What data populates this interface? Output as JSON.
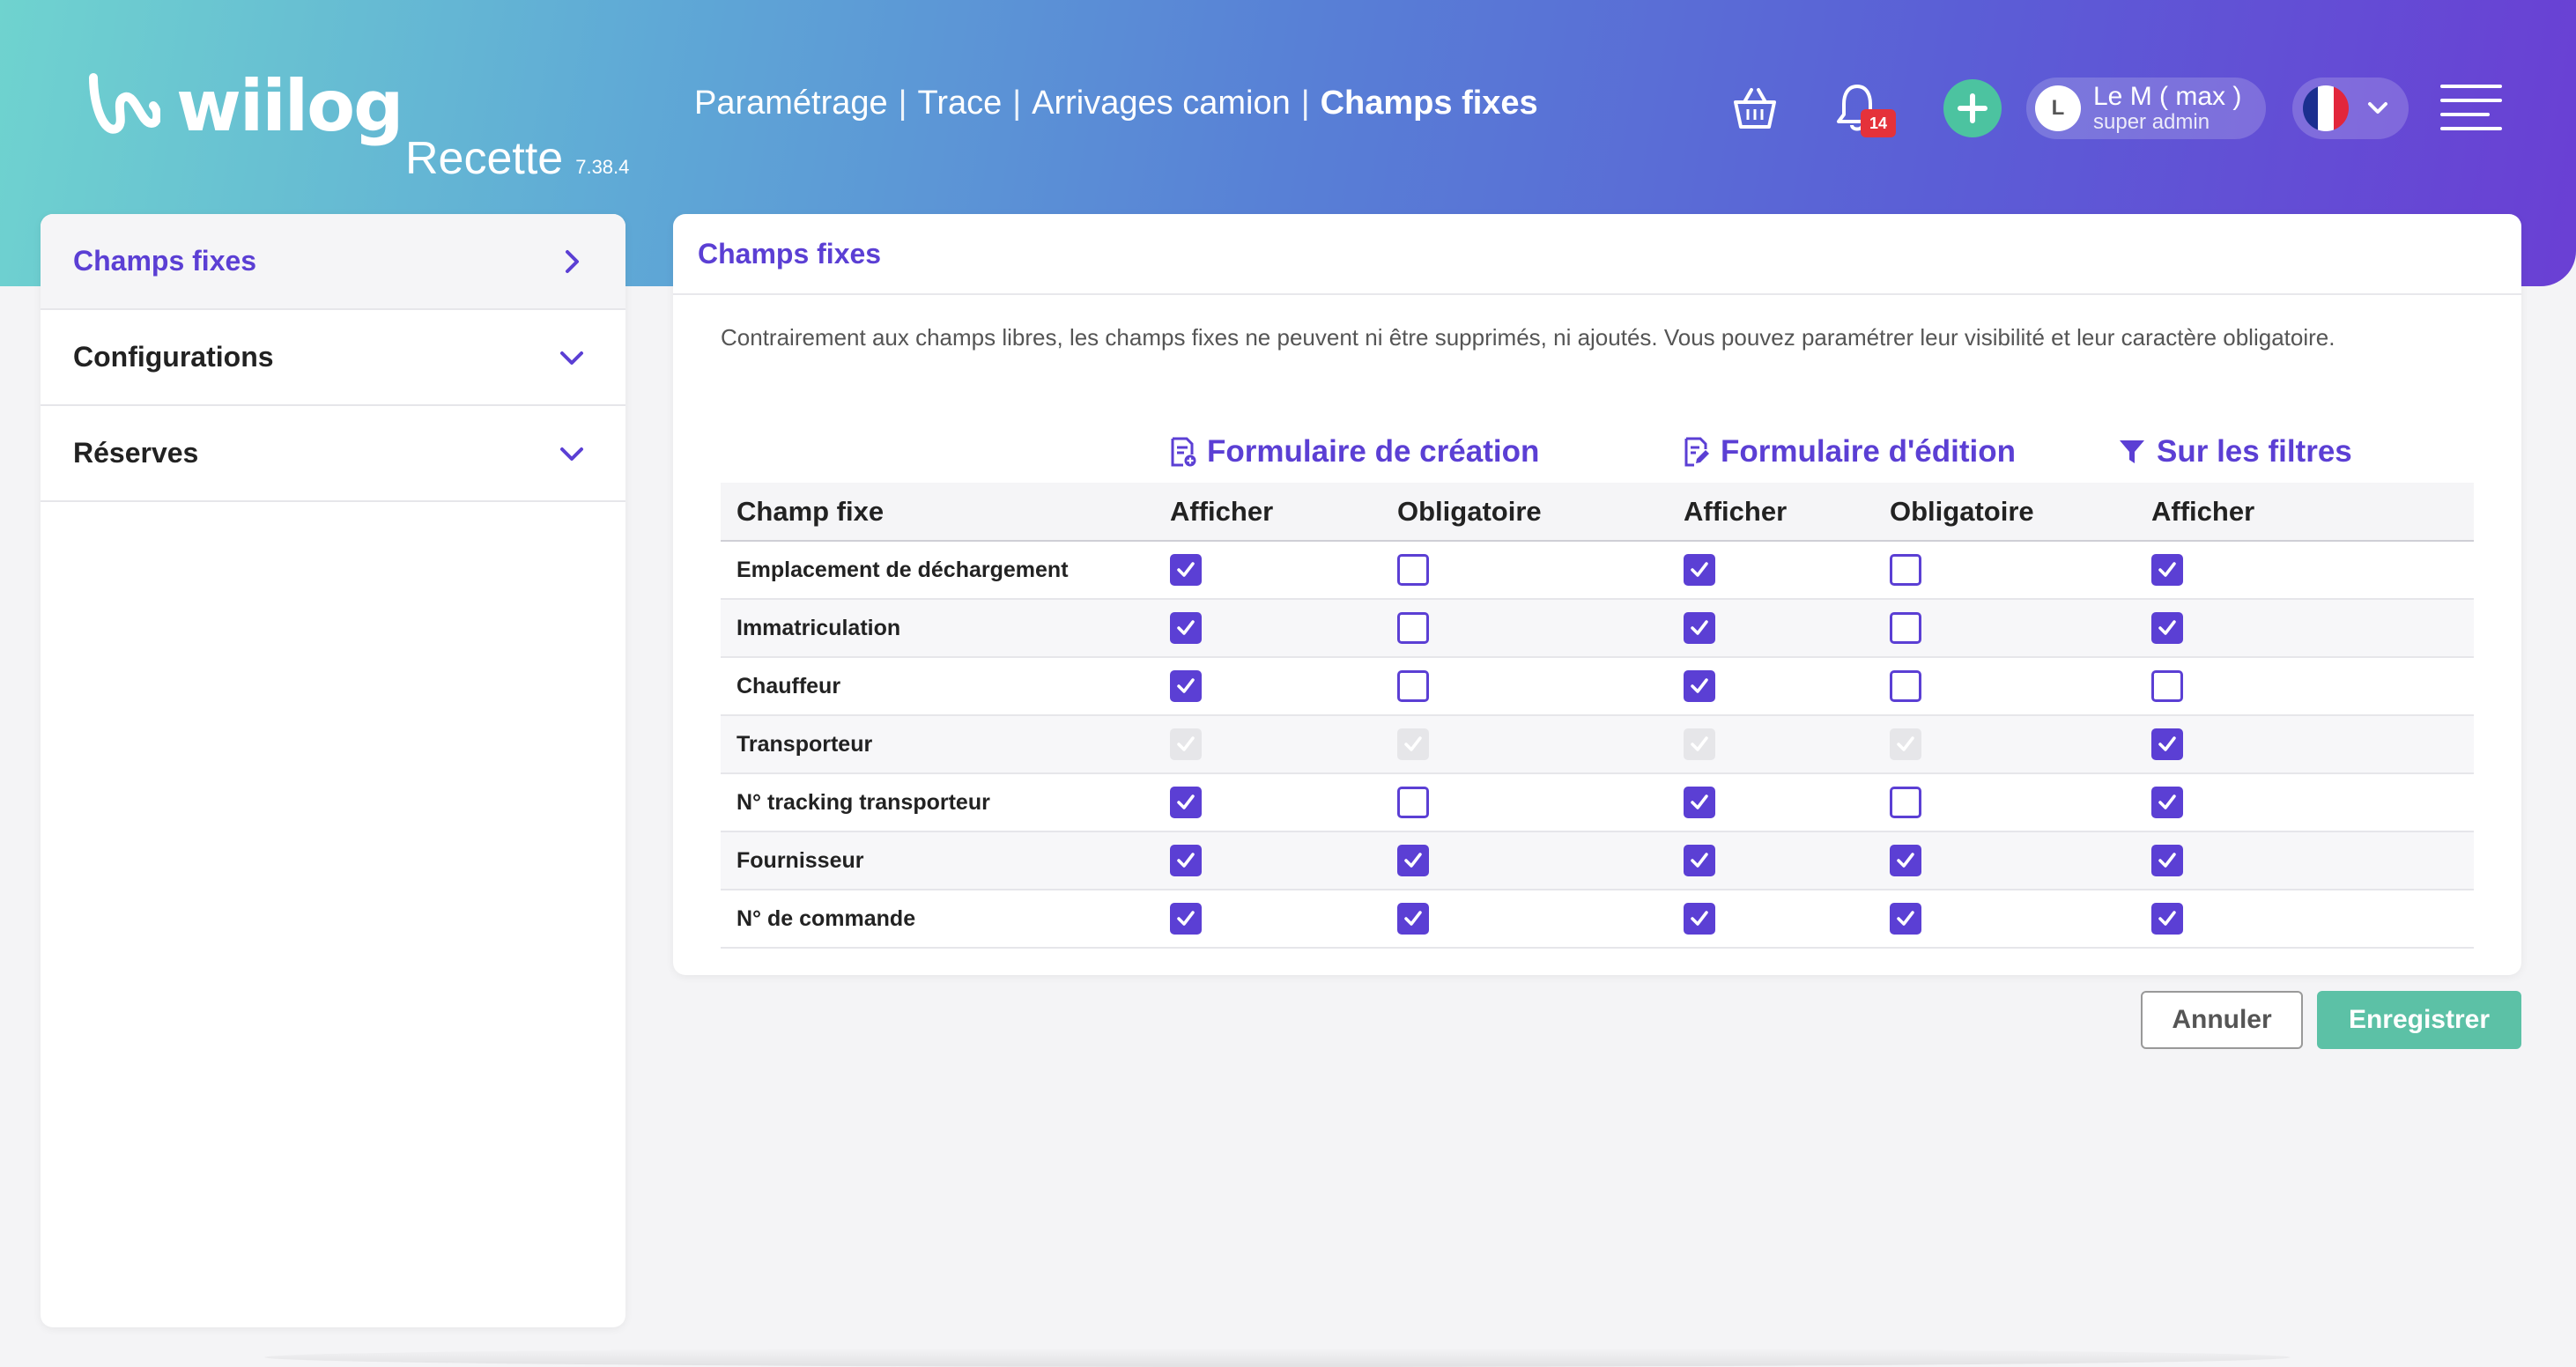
{
  "app": {
    "logo_text": "wiilog",
    "environment": "Recette",
    "version": "7.38.4"
  },
  "breadcrumb": {
    "items": [
      "Paramétrage",
      "Trace",
      "Arrivages camion"
    ],
    "separator": "|",
    "current": "Champs fixes"
  },
  "header": {
    "notifications_count": "14",
    "user": {
      "initial": "L",
      "name": "Le M ( max )",
      "role": "super admin"
    },
    "language_flag": "fr"
  },
  "sidebar": {
    "items": [
      {
        "label": "Champs fixes",
        "icon": "chevron-right-icon",
        "active": true
      },
      {
        "label": "Configurations",
        "icon": "chevron-down-icon",
        "active": false
      },
      {
        "label": "Réserves",
        "icon": "chevron-down-icon",
        "active": false
      }
    ]
  },
  "main": {
    "title": "Champs fixes",
    "description": "Contrairement aux champs libres, les champs fixes ne peuvent ni être supprimés, ni ajoutés. Vous pouvez paramétrer leur visibilité et leur caractère obligatoire.",
    "groups": {
      "creation": "Formulaire de création",
      "edition": "Formulaire d'édition",
      "filters": "Sur les filtres"
    },
    "columns": [
      "Champ fixe",
      "Afficher",
      "Obligatoire",
      "Afficher",
      "Obligatoire",
      "Afficher"
    ],
    "rows": [
      {
        "name": "Emplacement de déchargement",
        "values": [
          "on",
          "off",
          "on",
          "off",
          "on"
        ]
      },
      {
        "name": "Immatriculation",
        "values": [
          "on",
          "off",
          "on",
          "off",
          "on"
        ]
      },
      {
        "name": "Chauffeur",
        "values": [
          "on",
          "off",
          "on",
          "off",
          "off"
        ]
      },
      {
        "name": "Transporteur",
        "values": [
          "dis",
          "dis",
          "dis",
          "dis",
          "on"
        ]
      },
      {
        "name": "N° tracking transporteur",
        "values": [
          "on",
          "off",
          "on",
          "off",
          "on"
        ]
      },
      {
        "name": "Fournisseur",
        "values": [
          "on",
          "on",
          "on",
          "on",
          "on"
        ]
      },
      {
        "name": "N° de commande",
        "values": [
          "on",
          "on",
          "on",
          "on",
          "on"
        ]
      }
    ]
  },
  "actions": {
    "cancel_label": "Annuler",
    "save_label": "Enregistrer"
  },
  "colors": {
    "accent": "#5b3fd4",
    "save": "#5cc1a6",
    "plus": "#4cc3a0",
    "badge": "#e5323a"
  }
}
